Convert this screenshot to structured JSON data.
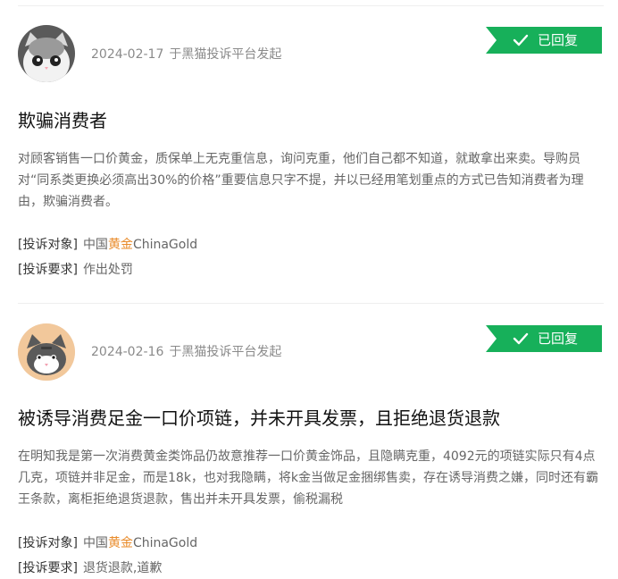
{
  "complaints": [
    {
      "avatar": {
        "icon": "gray-cat-avatar-icon",
        "bg": "#5a5a5a"
      },
      "date": "2024-02-17",
      "source": "于黑猫投诉平台发起",
      "status": "已回复",
      "title": "欺骗消费者",
      "content": "对顾客销售一口价黄金，质保单上无克重信息，询问克重，他们自己都不知道，就敢拿出来卖。导购员对“同系类更换必须高出30%的价格”重要信息只字不提，并以已经用笔划重点的方式已告知消费者为理由，欺骗消费者。",
      "target_label": "[投诉对象]",
      "target_parts": [
        "中国",
        "黄金",
        "ChinaGold"
      ],
      "demand_label": "[投诉要求]",
      "demand": "作出处罚"
    },
    {
      "avatar": {
        "icon": "tabby-cat-avatar-icon",
        "bg": "#f2c89b"
      },
      "date": "2024-02-16",
      "source": "于黑猫投诉平台发起",
      "status": "已回复",
      "title": "被诱导消费足金一口价项链，并未开具发票，且拒绝退货退款",
      "content": "在明知我是第一次消费黄金类饰品仍故意推荐一口价黄金饰品，且隐瞒克重，4092元的项链实际只有4点几克，项链并非足金，而是18k，也对我隐瞒，将k金当做足金捆绑售卖，存在诱导消费之嫌，同时还有霸王条款，离柜拒绝退货退款，售出并未开具发票，偷税漏税",
      "target_label": "[投诉对象]",
      "target_parts": [
        "中国",
        "黄金",
        "ChinaGold"
      ],
      "demand_label": "[投诉要求]",
      "demand": "退货退款,道歉"
    }
  ],
  "colors": {
    "badge": "#17b05a",
    "highlight": "#e98b2a"
  }
}
